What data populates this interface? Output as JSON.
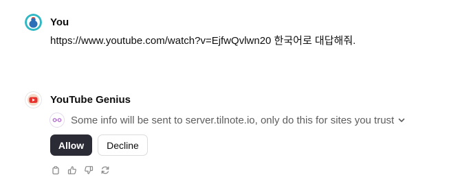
{
  "user_message": {
    "author": "You",
    "text": "https://www.youtube.com/watch?v=EjfwQvlwn20 한국어로 대답해줘.",
    "avatar_icon": "user-avatar-icon"
  },
  "assistant_message": {
    "author": "YouTube Genius",
    "avatar_icon": "youtube-genius-avatar-icon",
    "notice": {
      "text": "Some info will be sent to server.tilnote.io, only do this for sites you trust",
      "icon": "link-connection-icon",
      "expand_icon": "chevron-down-icon"
    },
    "buttons": {
      "allow": "Allow",
      "decline": "Decline"
    },
    "actions": [
      "copy-icon",
      "thumbs-up-icon",
      "thumbs-down-icon",
      "regenerate-icon"
    ]
  },
  "colors": {
    "allow_bg": "#2b2b36",
    "notice_text": "#5d5d5d",
    "accent_purple": "#b26fd1",
    "youtube_red": "#e8322e"
  }
}
